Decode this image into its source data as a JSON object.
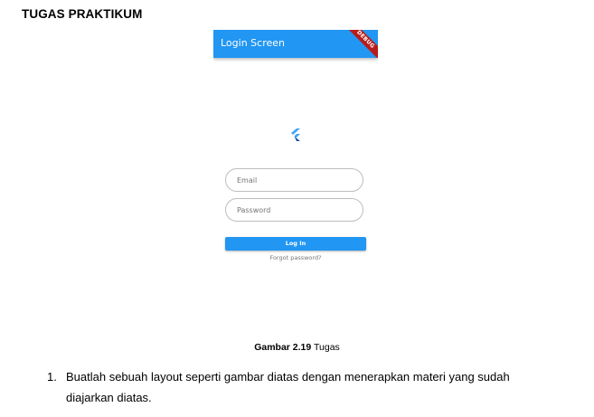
{
  "document": {
    "heading": "TUGAS PRAKTIKUM",
    "caption": {
      "label": "Gambar 2.19",
      "text": "Tugas"
    },
    "tasks": [
      {
        "number": "1.",
        "line1": "Buatlah sebuah layout seperti gambar diatas dengan menerapkan materi yang sudah",
        "line2": "diajarkan diatas."
      }
    ]
  },
  "app": {
    "appbar_title": "Login Screen",
    "debug_banner": "DEBUG",
    "email": {
      "placeholder": "Email",
      "value": ""
    },
    "password": {
      "placeholder": "Password",
      "value": ""
    },
    "login_button": "Log In",
    "forgot_password": "Forgot password?",
    "colors": {
      "primary": "#2196f3",
      "banner": "#b71c1c",
      "logo_light": "#42a5f5",
      "logo_dark": "#0d47a1"
    },
    "logo_icon": "flutter-logo-icon"
  }
}
